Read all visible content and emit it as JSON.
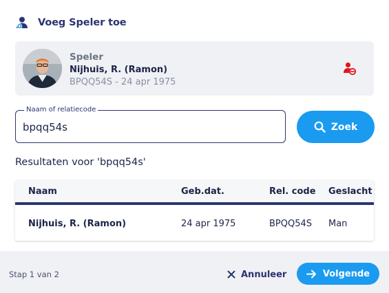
{
  "header": {
    "title": "Voeg Speler toe",
    "icon": "add-user-icon"
  },
  "player": {
    "label": "Speler",
    "name": "Nijhuis, R. (Ramon)",
    "meta": "BPQQ54S - 24 apr 1975",
    "remove_icon": "remove-user-icon"
  },
  "search": {
    "legend": "Naam of relatiecode",
    "value": "bpqq54s",
    "button_label": "Zoek"
  },
  "results": {
    "title": "Resultaten voor 'bpqq54s'",
    "columns": [
      "Naam",
      "Geb.dat.",
      "Rel. code",
      "Geslacht"
    ],
    "rows": [
      [
        "Nijhuis, R. (Ramon)",
        "24 apr 1975",
        "BPQQ54S",
        "Man"
      ]
    ]
  },
  "footer": {
    "step": "Stap 1 van 2",
    "cancel_label": "Annuleer",
    "next_label": "Volgende"
  },
  "colors": {
    "accent": "#1a9bf0",
    "navy": "#2b3470",
    "danger": "#e0161b"
  }
}
